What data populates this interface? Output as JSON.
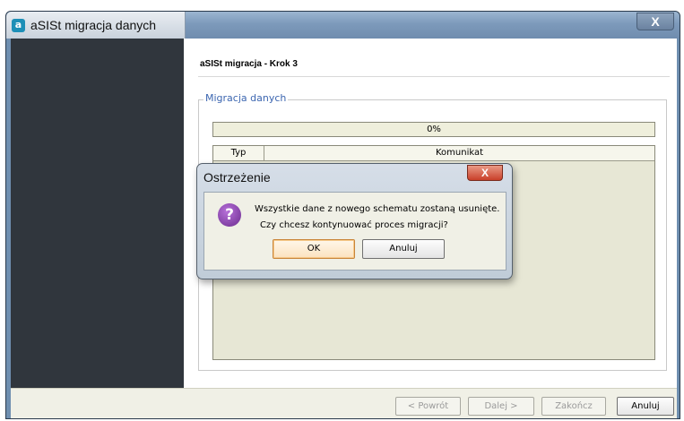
{
  "window": {
    "title": "aSISt migracja danych",
    "app_icon_letter": "a",
    "close_glyph": "X"
  },
  "wizard": {
    "step_title": "aSISt migracja - Krok 3",
    "group_label": "Migracja danych",
    "progress_text": "0%",
    "progress_value": 0,
    "log_table": {
      "columns": [
        "Typ",
        "Komunikat"
      ],
      "rows": []
    },
    "buttons": {
      "back": "< Powrót",
      "next": "Dalej >",
      "finish": "Zakończ",
      "cancel": "Anuluj"
    }
  },
  "dialog": {
    "title": "Ostrzeżenie",
    "close_glyph": "X",
    "icon": "question-icon",
    "icon_glyph": "?",
    "message_line1": "Wszystkie dane z nowego schematu zostaną usunięte.",
    "message_line2": "Czy chcesz kontynuować proces migracji?",
    "ok_label": "OK",
    "cancel_label": "Anuluj"
  },
  "colors": {
    "sidebar": "#30363d",
    "group_label": "#3c66b0",
    "question_icon": "#8b3fb3",
    "dialog_close": "#c9402a"
  }
}
